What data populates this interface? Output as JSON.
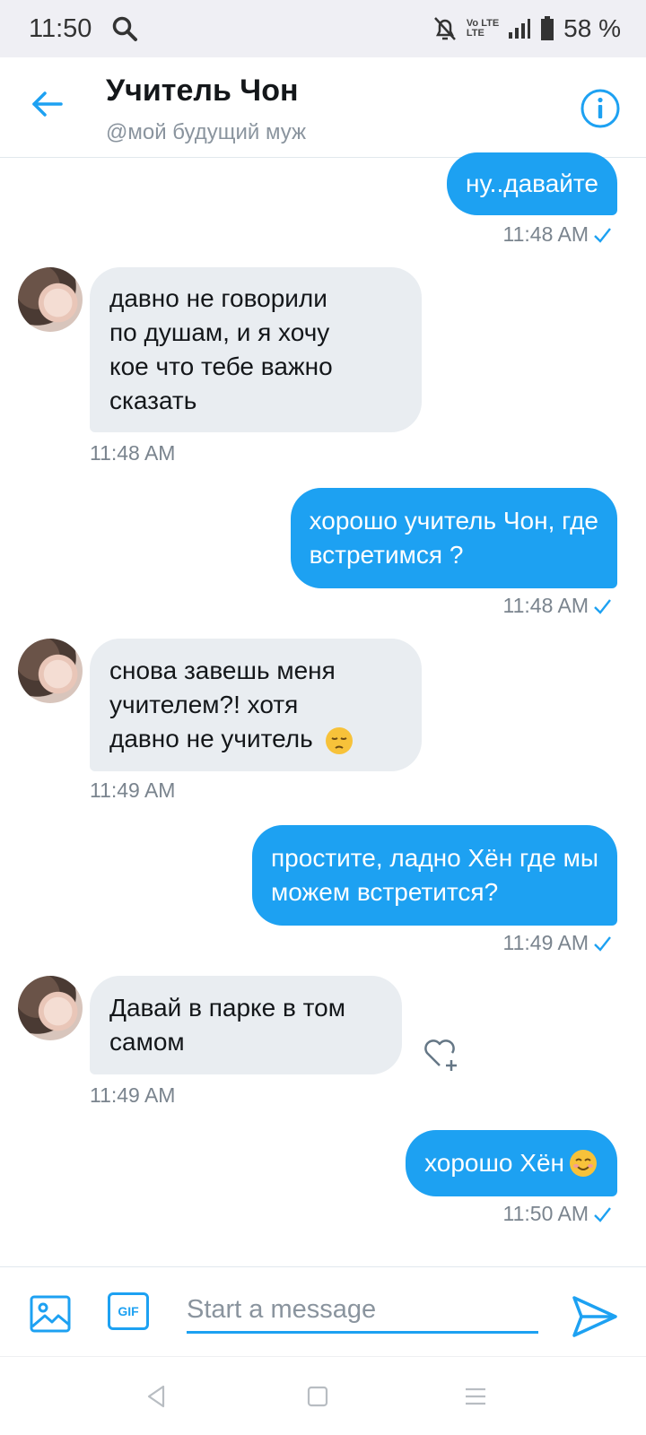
{
  "status": {
    "time": "11:50",
    "network_top": "Vo LTE",
    "network_bottom": "LTE",
    "battery": "58 %"
  },
  "header": {
    "title": "Учитель Чон",
    "subtitle": "@мой будущий муж"
  },
  "messages": [
    {
      "dir": "out",
      "text": "ну..давайте",
      "time": "11:48 AM"
    },
    {
      "dir": "in",
      "lines": [
        "давно не говорили",
        "по душам, и я хочу",
        "кое что тебе важно",
        "сказать"
      ],
      "time": "11:48 AM"
    },
    {
      "dir": "out",
      "lines": [
        "хорошо учитель Чон, где",
        "встретимся ?"
      ],
      "time": "11:48 AM"
    },
    {
      "dir": "in",
      "lines": [
        "снова завешь меня",
        "учителем?! хотя",
        "давно не учитель"
      ],
      "emoji": "pensive-face",
      "time": "11:49 AM"
    },
    {
      "dir": "out",
      "lines": [
        "простите, ладно Хён где мы",
        "можем встретится?"
      ],
      "time": "11:49 AM"
    },
    {
      "dir": "in",
      "lines": [
        "Давай в парке в том",
        "самом"
      ],
      "time": "11:49 AM"
    },
    {
      "dir": "out",
      "text": "хорошо Хён",
      "emoji": "smiling-face",
      "time": "11:50 AM"
    }
  ],
  "composer": {
    "placeholder": "Start a message",
    "gif_label": "GIF"
  },
  "colors": {
    "accent": "#1da1f2",
    "incoming_bubble": "#e9edf1"
  }
}
